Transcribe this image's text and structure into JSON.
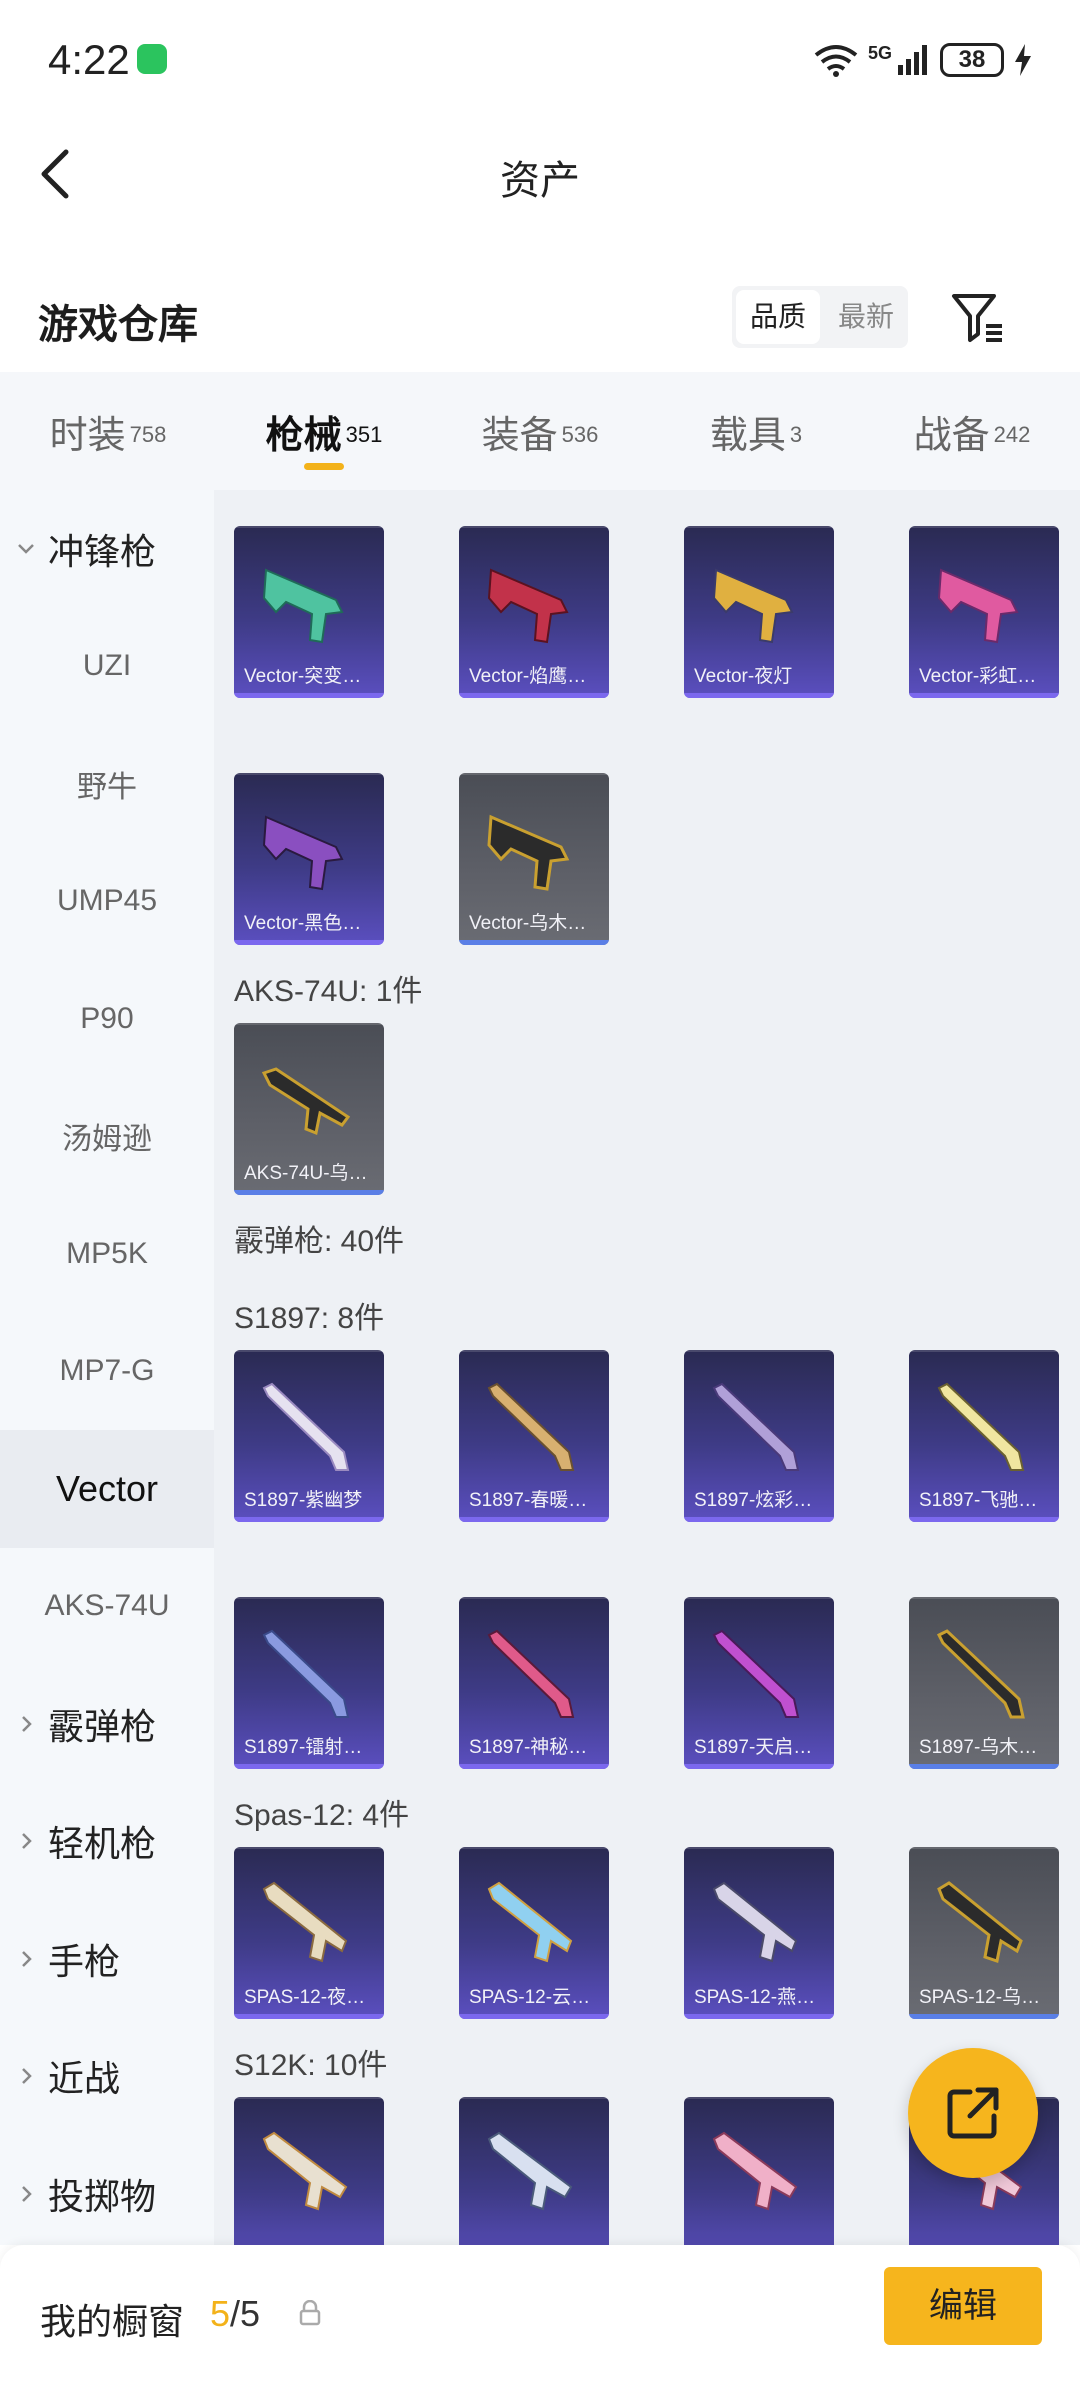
{
  "status": {
    "time": "4:22",
    "battery": "38",
    "network": "5G"
  },
  "nav": {
    "title": "资产"
  },
  "warehouse": {
    "title": "游戏仓库",
    "sort_options": [
      "品质",
      "最新"
    ]
  },
  "tabs": [
    {
      "label": "时装",
      "count": "758"
    },
    {
      "label": "枪械",
      "count": "351"
    },
    {
      "label": "装备",
      "count": "536"
    },
    {
      "label": "载具",
      "count": "3"
    },
    {
      "label": "战备",
      "count": "242"
    }
  ],
  "sidebar": [
    {
      "label": "冲锋枪",
      "group": true,
      "expanded": true
    },
    {
      "label": "UZI"
    },
    {
      "label": "野牛"
    },
    {
      "label": "UMP45"
    },
    {
      "label": "P90"
    },
    {
      "label": "汤姆逊"
    },
    {
      "label": "MP5K"
    },
    {
      "label": "MP7-G"
    },
    {
      "label": "Vector",
      "active": true
    },
    {
      "label": "AKS-74U"
    },
    {
      "label": "霰弹枪",
      "group": true
    },
    {
      "label": "轻机枪",
      "group": true
    },
    {
      "label": "手枪",
      "group": true
    },
    {
      "label": "近战",
      "group": true
    },
    {
      "label": "投掷物",
      "group": true
    }
  ],
  "sections": {
    "aks": "AKS-74U: 1件",
    "shotgun": "霰弹枪: 40件",
    "s1897": "S1897: 8件",
    "spas": "Spas-12: 4件",
    "s12k": "S12K: 10件"
  },
  "items": {
    "vector": [
      "Vector-突变…",
      "Vector-焰鹰…",
      "Vector-夜灯",
      "Vector-彩虹…",
      "Vector-黑色…",
      "Vector-乌木…"
    ],
    "aks": [
      "AKS-74U-乌…"
    ],
    "s1897": [
      "S1897-紫幽梦",
      "S1897-春暖…",
      "S1897-炫彩…",
      "S1897-飞驰…",
      "S1897-镭射…",
      "S1897-神秘…",
      "S1897-天启…",
      "S1897-乌木…"
    ],
    "spas": [
      "SPAS-12-夜…",
      "SPAS-12-云…",
      "SPAS-12-燕…",
      "SPAS-12-乌…"
    ]
  },
  "bottom": {
    "label": "我的橱窗",
    "current": "5",
    "total": "/5",
    "edit": "编辑"
  }
}
